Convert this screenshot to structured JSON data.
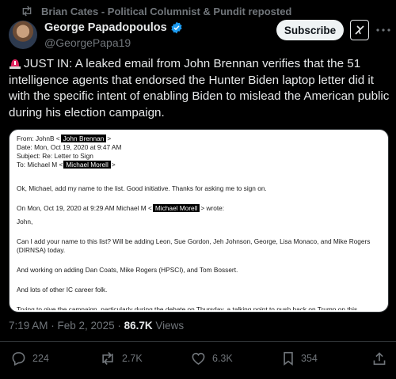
{
  "repost_line": "Brian Cates - Political Columnist & Pundit reposted",
  "author": {
    "name": "George Papadopoulos",
    "handle": "@GeorgePapa19"
  },
  "header": {
    "subscribe_label": "Subscribe"
  },
  "tweet": {
    "text": "JUST IN: A leaked email from John Brennan verifies that the 51 intelligence agents that endorsed the Hunter Biden laptop letter did it with the specific intent of enabling Biden to mislead the American public during his election campaign."
  },
  "email": {
    "from_prefix": "From: JohnB <",
    "from_redacted": "John Brennan",
    "date": "Date: Mon, Oct 19, 2020 at 9:47 AM",
    "subject": "Subject: Re: Letter to Sign",
    "to_prefix": "To: Michael M <",
    "to_redacted": "Michael Morell",
    "body1": "Ok, Michael, add my name to the list.  Good initiative.  Thanks for asking me to sign on.",
    "quote_prefix": "On Mon, Oct 19, 2020 at 9:29 AM Michael M <",
    "quote_redacted": "Michael Morell",
    "quote_suffix": "> wrote:",
    "greeting": "John,",
    "para1": "Can I add your name to this list?  Will be adding Leon, Sue Gordon, Jeh Johnson, George, Lisa Monaco, and Mike Rogers (DIRNSA) today.",
    "para2": "And working on adding Dan Coats, Mike Rogers (HPSCI), and Tom Bossert.",
    "para3": "And lots of other IC career folk.",
    "para4": "Trying to give the campaign, particularly during the debate on Thursday, a talking point to push back on Trump on this"
  },
  "meta": {
    "time": "7:19 AM · Feb 2, 2025 · ",
    "views_count": "86.7K",
    "views_label": " Views"
  },
  "stats": {
    "replies": "224",
    "reposts": "2.7K",
    "likes": "6.3K",
    "bookmarks": "354"
  },
  "colors": {
    "background": "#000000",
    "text": "#e7e9ea",
    "muted": "#71767b",
    "verified": "#1d9bf0"
  }
}
